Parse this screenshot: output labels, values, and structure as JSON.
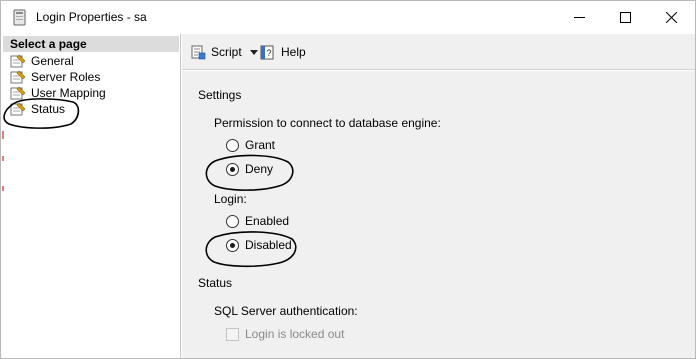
{
  "window": {
    "title": "Login Properties - sa"
  },
  "page_selector": {
    "header": "Select a page",
    "items": [
      {
        "label": "General",
        "icon": "wrench-page-icon"
      },
      {
        "label": "Server Roles",
        "icon": "wrench-page-icon"
      },
      {
        "label": "User Mapping",
        "icon": "wrench-page-icon"
      },
      {
        "label": "Status",
        "icon": "wrench-page-icon"
      }
    ]
  },
  "toolbar": {
    "script_label": "Script",
    "help_label": "Help"
  },
  "settings": {
    "section_title": "Settings",
    "permission_label": "Permission to connect to database engine:",
    "permission_options": [
      {
        "label": "Grant",
        "checked": false
      },
      {
        "label": "Deny",
        "checked": true
      }
    ],
    "login_label": "Login:",
    "login_options": [
      {
        "label": "Enabled",
        "checked": false
      },
      {
        "label": "Disabled",
        "checked": true
      }
    ]
  },
  "status": {
    "section_title": "Status",
    "auth_label": "SQL Server authentication:",
    "locked_out_label": "Login is locked out",
    "locked_out_checked": false
  }
}
